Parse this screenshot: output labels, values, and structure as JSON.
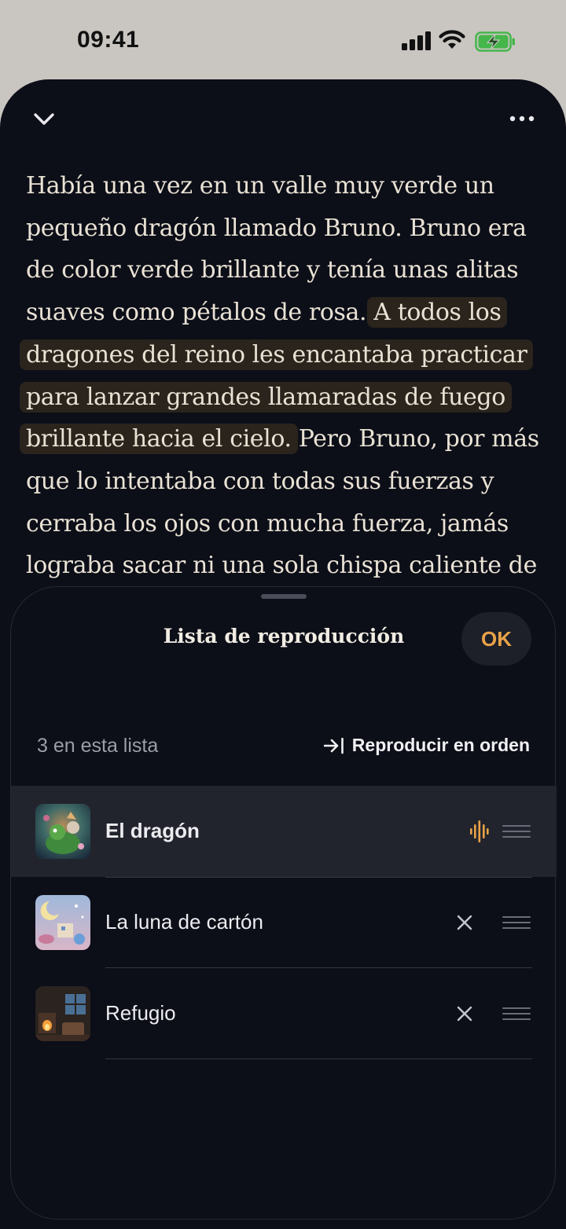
{
  "status_bar": {
    "time": "09:41"
  },
  "story": {
    "before": "Había una vez en un valle muy verde un pequeño dragón llamado Bruno. Bruno era de color verde brillante y tenía unas alitas suaves como pétalos de rosa. ",
    "highlighted": "A todos los dragones del reino les encantaba practicar para lanzar grandes llamaradas de fuego brillante hacia el cielo.",
    "after": " Pero Bruno, por más que lo intentaba con todas sus fuerzas y cerraba los ojos con mucha fuerza, jamás lograba sacar ni una sola chispa caliente de"
  },
  "playlist": {
    "title": "Lista de reproducción",
    "ok_label": "OK",
    "count_label": "3 en esta lista",
    "order_label": "Reproducir en orden",
    "items": [
      {
        "title": "El dragón",
        "playing": true
      },
      {
        "title": "La luna de cartón",
        "playing": false
      },
      {
        "title": "Refugio",
        "playing": false
      }
    ]
  },
  "colors": {
    "accent": "#e9a247",
    "background": "#0c0e18",
    "highlight": "#2a241d",
    "active_row": "#22242d"
  }
}
